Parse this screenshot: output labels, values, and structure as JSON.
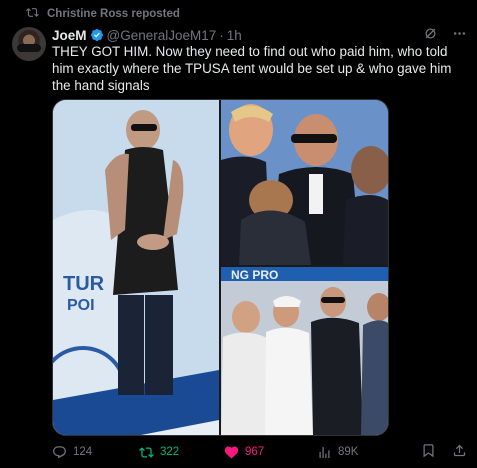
{
  "repost": {
    "text": "Christine Ross reposted"
  },
  "tweet": {
    "name": "JoeM",
    "handle": "@GeneralJoeM17",
    "separator": "·",
    "time": "1h",
    "text": "THEY GOT HIM. Now they need to find out who paid him, who told him exactly where the TPUSA tent would be set up & who gave him the hand signals"
  },
  "stats": {
    "replies": "124",
    "reposts": "322",
    "likes": "967",
    "views": "89K"
  },
  "colors": {
    "repost_green": "#00ba7c",
    "like_pink": "#f91880",
    "verified_blue": "#1d9bf0",
    "muted": "#71767b"
  }
}
